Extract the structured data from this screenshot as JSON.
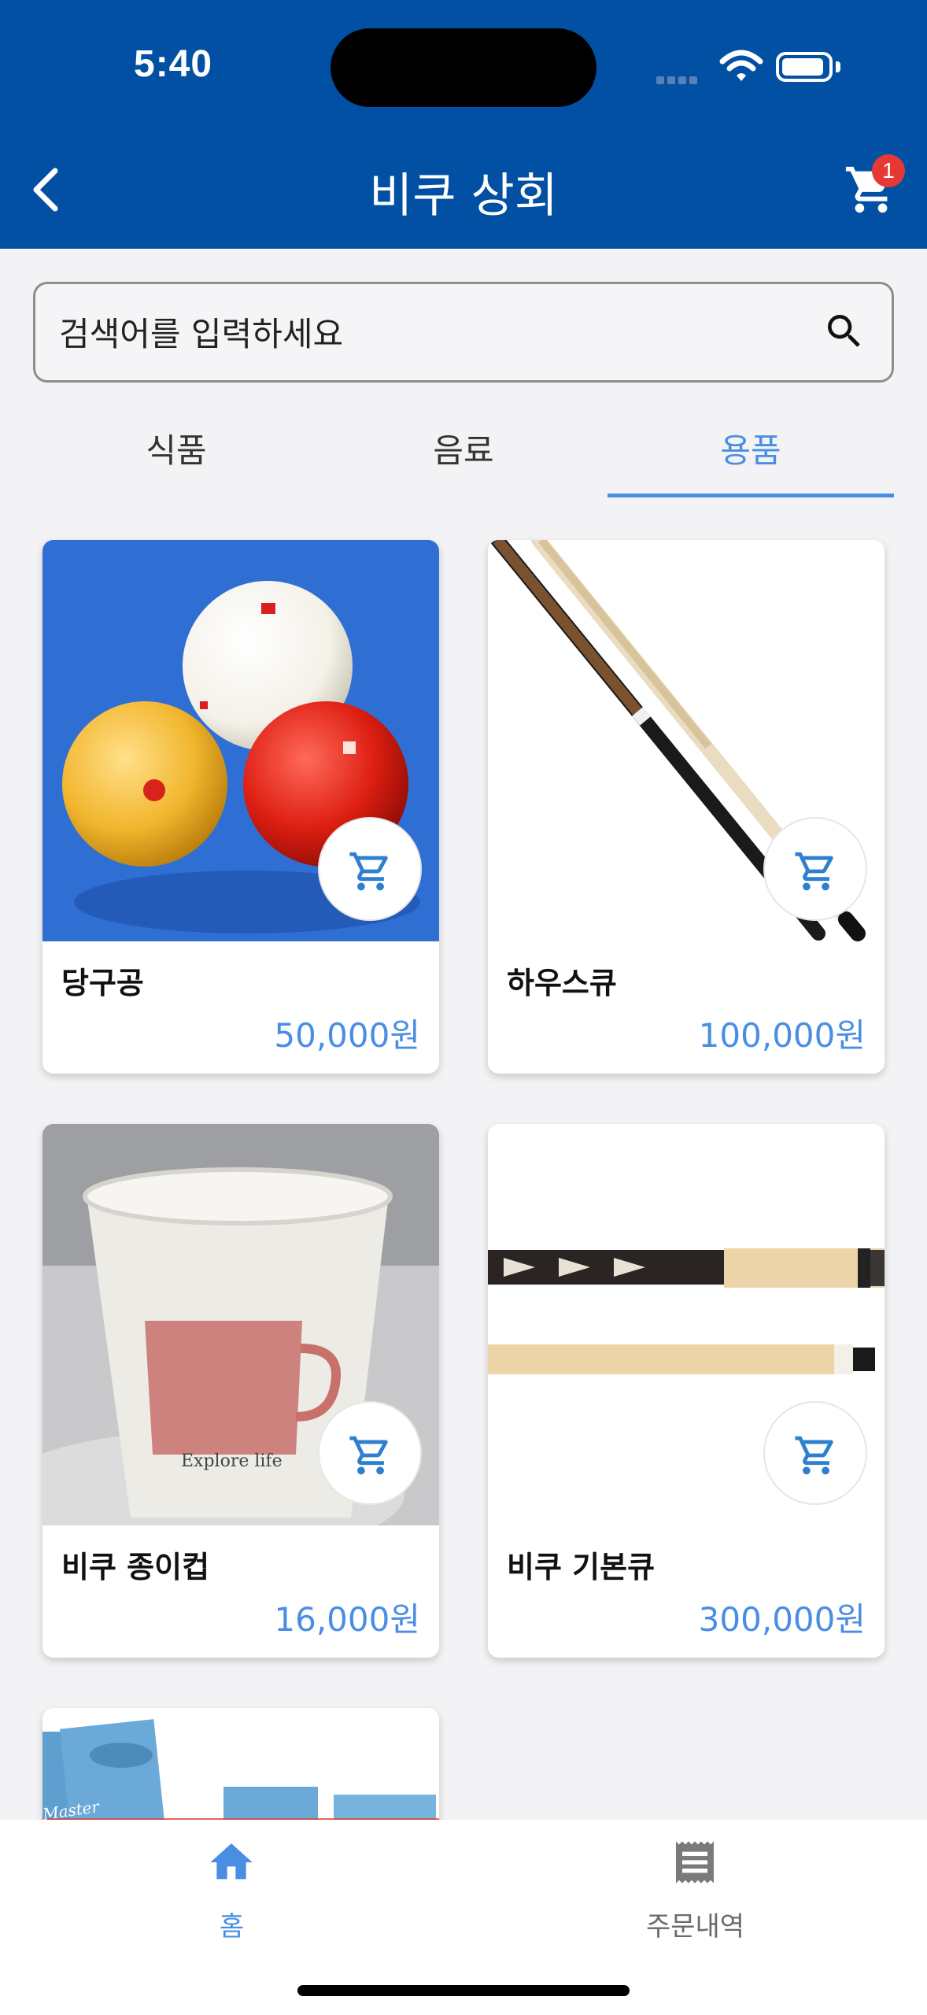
{
  "status_bar": {
    "time": "5:40"
  },
  "header": {
    "title": "비쿠 상회",
    "cart_count": "1"
  },
  "search": {
    "placeholder": "검색어를 입력하세요"
  },
  "tabs": [
    {
      "label": "식품",
      "active": false
    },
    {
      "label": "음료",
      "active": false
    },
    {
      "label": "용품",
      "active": true
    }
  ],
  "products": [
    {
      "name": "당구공",
      "price": "50,000원",
      "image": "billiard-balls"
    },
    {
      "name": "하우스큐",
      "price": "100,000원",
      "image": "house-cue"
    },
    {
      "name": "비쿠 종이컵",
      "price": "16,000원",
      "image": "paper-cup",
      "cup_text": "Explore life"
    },
    {
      "name": "비쿠 기본큐",
      "price": "300,000원",
      "image": "basic-cue"
    },
    {
      "name": "",
      "price": "",
      "image": "chalk",
      "chalk_text": "Master"
    }
  ],
  "bottom_nav": [
    {
      "label": "홈",
      "icon": "home-icon",
      "active": true
    },
    {
      "label": "주문내역",
      "icon": "receipt-icon",
      "active": false
    }
  ],
  "colors": {
    "brand": "#0250a4",
    "accent": "#4a8ee4",
    "badge": "#e53935"
  }
}
